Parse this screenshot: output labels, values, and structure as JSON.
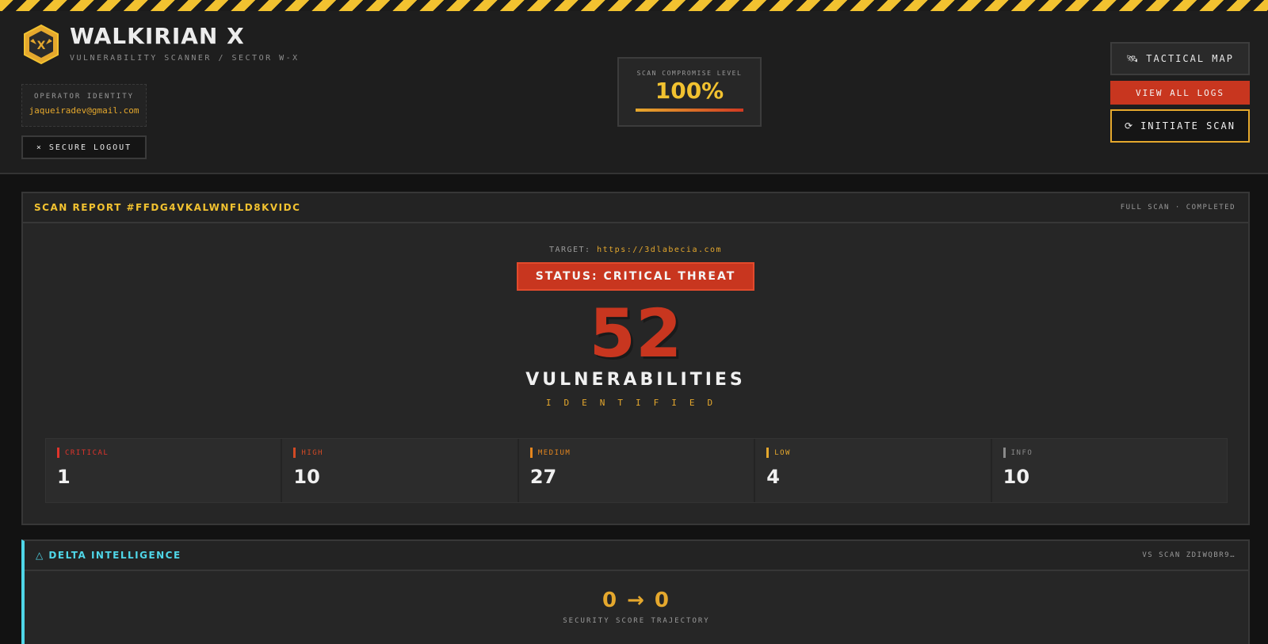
{
  "header": {
    "app_title": "WALKIRIAN X",
    "subtitle": "VULNERABILITY SCANNER / SECTOR W-X",
    "operator_label": "OPERATOR IDENTITY",
    "operator_email": "jaqueiradev@gmail.com",
    "logout_label": "× SECURE LOGOUT",
    "compromise_label": "SCAN COMPROMISE LEVEL",
    "compromise_value": "100%",
    "compromise_fraction": 1.0,
    "tactical_map_label": "TACTICAL MAP",
    "tactical_map_icon": "🛰",
    "view_logs_label": "VIEW ALL LOGS",
    "initiate_scan_label": "INITIATE SCAN",
    "initiate_scan_icon": "⟳"
  },
  "report": {
    "title": "SCAN REPORT #FFDG4VKALWNFLD8KVIDC",
    "meta": "FULL SCAN · COMPLETED",
    "target_label": "TARGET:",
    "target_url": "https://3dlabecia.com",
    "status": "STATUS: CRITICAL THREAT",
    "total": "52",
    "total_label": "VULNERABILITIES",
    "total_sublabel": "IDENTIFIED",
    "severities": [
      {
        "label": "CRITICAL",
        "value": "1",
        "color": "#e0342b"
      },
      {
        "label": "HIGH",
        "value": "10",
        "color": "#d24a25"
      },
      {
        "label": "MEDIUM",
        "value": "27",
        "color": "#e5861e"
      },
      {
        "label": "LOW",
        "value": "4",
        "color": "#e5a82d"
      },
      {
        "label": "INFO",
        "value": "10",
        "color": "#8a8a8a"
      }
    ]
  },
  "delta": {
    "title": "△ DELTA INTELLIGENCE",
    "meta": "VS SCAN ZDIWQBR9…",
    "trajectory": "0 → 0",
    "trajectory_label": "SECURITY SCORE TRAJECTORY"
  },
  "colors": {
    "accent_yellow": "#f2c230",
    "accent_orange": "#e5a82d",
    "danger_red": "#c8361f",
    "cyan": "#4fd6e8"
  }
}
